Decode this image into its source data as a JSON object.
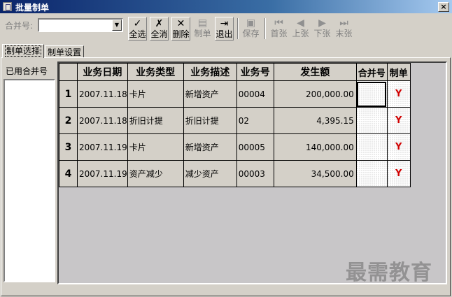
{
  "window": {
    "title": "批量制单",
    "close_symbol": "×"
  },
  "toolbar": {
    "merge_label": "合并号:",
    "merge_value": "",
    "buttons": [
      {
        "id": "select-all",
        "label": "全选",
        "icon": "select-all-icon",
        "glyph": "✓",
        "enabled": true
      },
      {
        "id": "deselect-all",
        "label": "全消",
        "icon": "deselect-all-icon",
        "glyph": "✗",
        "enabled": true
      },
      {
        "id": "delete",
        "label": "删除",
        "icon": "delete-icon",
        "glyph": "✕",
        "enabled": true
      },
      {
        "id": "make",
        "label": "制单",
        "icon": "voucher-icon",
        "glyph": "▤",
        "enabled": false
      },
      {
        "id": "exit",
        "label": "退出",
        "icon": "exit-icon",
        "glyph": "⇥",
        "enabled": true
      },
      {
        "id": "save",
        "label": "保存",
        "icon": "save-icon",
        "glyph": "▣",
        "enabled": false
      },
      {
        "id": "first",
        "label": "首张",
        "icon": "first-page-icon",
        "glyph": "⏮",
        "enabled": false
      },
      {
        "id": "prev",
        "label": "上张",
        "icon": "prev-page-icon",
        "glyph": "◀",
        "enabled": false
      },
      {
        "id": "next",
        "label": "下张",
        "icon": "next-page-icon",
        "glyph": "▶",
        "enabled": false
      },
      {
        "id": "last",
        "label": "末张",
        "icon": "last-page-icon",
        "glyph": "⏭",
        "enabled": false
      }
    ]
  },
  "tabs": [
    {
      "label": "制单选择",
      "active": true
    },
    {
      "label": "制单设置",
      "active": false
    }
  ],
  "left_panel": {
    "label": "已用合并号"
  },
  "grid": {
    "headers": [
      "",
      "业务日期",
      "业务类型",
      "业务描述",
      "业务号",
      "发生额",
      "合并号",
      "制单"
    ],
    "rows": [
      {
        "no": "1",
        "date": "2007.11.18",
        "type": "卡片",
        "desc": "新增资产",
        "code": "00004",
        "amount": "200,000.00",
        "merge": "",
        "flag": "Y"
      },
      {
        "no": "2",
        "date": "2007.11.18",
        "type": "折旧计提",
        "desc": "折旧计提",
        "code": "02",
        "amount": "4,395.15",
        "merge": "",
        "flag": "Y"
      },
      {
        "no": "3",
        "date": "2007.11.19",
        "type": "卡片",
        "desc": "新增资产",
        "code": "00005",
        "amount": "140,000.00",
        "merge": "",
        "flag": "Y"
      },
      {
        "no": "4",
        "date": "2007.11.19",
        "type": "资产减少",
        "desc": "减少资产",
        "code": "00003",
        "amount": "34,500.00",
        "merge": "",
        "flag": "Y"
      }
    ]
  },
  "watermark": "最需教育"
}
